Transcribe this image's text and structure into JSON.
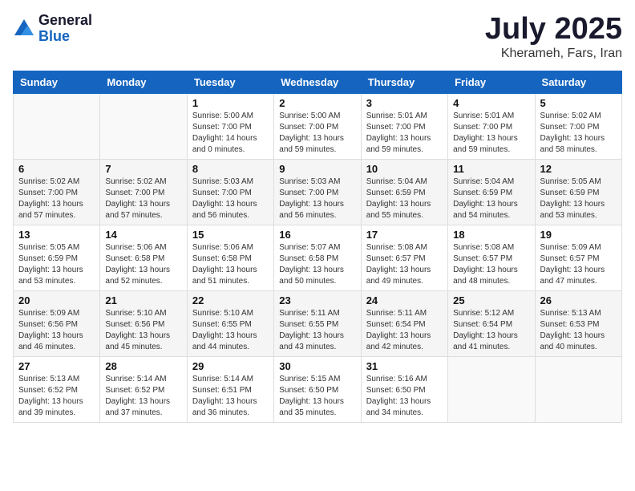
{
  "header": {
    "logo_general": "General",
    "logo_blue": "Blue",
    "title": "July 2025",
    "subtitle": "Kherameh, Fars, Iran"
  },
  "calendar": {
    "weekdays": [
      "Sunday",
      "Monday",
      "Tuesday",
      "Wednesday",
      "Thursday",
      "Friday",
      "Saturday"
    ],
    "rows": [
      [
        {
          "day": "",
          "info": ""
        },
        {
          "day": "",
          "info": ""
        },
        {
          "day": "1",
          "info": "Sunrise: 5:00 AM\nSunset: 7:00 PM\nDaylight: 14 hours\nand 0 minutes."
        },
        {
          "day": "2",
          "info": "Sunrise: 5:00 AM\nSunset: 7:00 PM\nDaylight: 13 hours\nand 59 minutes."
        },
        {
          "day": "3",
          "info": "Sunrise: 5:01 AM\nSunset: 7:00 PM\nDaylight: 13 hours\nand 59 minutes."
        },
        {
          "day": "4",
          "info": "Sunrise: 5:01 AM\nSunset: 7:00 PM\nDaylight: 13 hours\nand 59 minutes."
        },
        {
          "day": "5",
          "info": "Sunrise: 5:02 AM\nSunset: 7:00 PM\nDaylight: 13 hours\nand 58 minutes."
        }
      ],
      [
        {
          "day": "6",
          "info": "Sunrise: 5:02 AM\nSunset: 7:00 PM\nDaylight: 13 hours\nand 57 minutes."
        },
        {
          "day": "7",
          "info": "Sunrise: 5:02 AM\nSunset: 7:00 PM\nDaylight: 13 hours\nand 57 minutes."
        },
        {
          "day": "8",
          "info": "Sunrise: 5:03 AM\nSunset: 7:00 PM\nDaylight: 13 hours\nand 56 minutes."
        },
        {
          "day": "9",
          "info": "Sunrise: 5:03 AM\nSunset: 7:00 PM\nDaylight: 13 hours\nand 56 minutes."
        },
        {
          "day": "10",
          "info": "Sunrise: 5:04 AM\nSunset: 6:59 PM\nDaylight: 13 hours\nand 55 minutes."
        },
        {
          "day": "11",
          "info": "Sunrise: 5:04 AM\nSunset: 6:59 PM\nDaylight: 13 hours\nand 54 minutes."
        },
        {
          "day": "12",
          "info": "Sunrise: 5:05 AM\nSunset: 6:59 PM\nDaylight: 13 hours\nand 53 minutes."
        }
      ],
      [
        {
          "day": "13",
          "info": "Sunrise: 5:05 AM\nSunset: 6:59 PM\nDaylight: 13 hours\nand 53 minutes."
        },
        {
          "day": "14",
          "info": "Sunrise: 5:06 AM\nSunset: 6:58 PM\nDaylight: 13 hours\nand 52 minutes."
        },
        {
          "day": "15",
          "info": "Sunrise: 5:06 AM\nSunset: 6:58 PM\nDaylight: 13 hours\nand 51 minutes."
        },
        {
          "day": "16",
          "info": "Sunrise: 5:07 AM\nSunset: 6:58 PM\nDaylight: 13 hours\nand 50 minutes."
        },
        {
          "day": "17",
          "info": "Sunrise: 5:08 AM\nSunset: 6:57 PM\nDaylight: 13 hours\nand 49 minutes."
        },
        {
          "day": "18",
          "info": "Sunrise: 5:08 AM\nSunset: 6:57 PM\nDaylight: 13 hours\nand 48 minutes."
        },
        {
          "day": "19",
          "info": "Sunrise: 5:09 AM\nSunset: 6:57 PM\nDaylight: 13 hours\nand 47 minutes."
        }
      ],
      [
        {
          "day": "20",
          "info": "Sunrise: 5:09 AM\nSunset: 6:56 PM\nDaylight: 13 hours\nand 46 minutes."
        },
        {
          "day": "21",
          "info": "Sunrise: 5:10 AM\nSunset: 6:56 PM\nDaylight: 13 hours\nand 45 minutes."
        },
        {
          "day": "22",
          "info": "Sunrise: 5:10 AM\nSunset: 6:55 PM\nDaylight: 13 hours\nand 44 minutes."
        },
        {
          "day": "23",
          "info": "Sunrise: 5:11 AM\nSunset: 6:55 PM\nDaylight: 13 hours\nand 43 minutes."
        },
        {
          "day": "24",
          "info": "Sunrise: 5:11 AM\nSunset: 6:54 PM\nDaylight: 13 hours\nand 42 minutes."
        },
        {
          "day": "25",
          "info": "Sunrise: 5:12 AM\nSunset: 6:54 PM\nDaylight: 13 hours\nand 41 minutes."
        },
        {
          "day": "26",
          "info": "Sunrise: 5:13 AM\nSunset: 6:53 PM\nDaylight: 13 hours\nand 40 minutes."
        }
      ],
      [
        {
          "day": "27",
          "info": "Sunrise: 5:13 AM\nSunset: 6:52 PM\nDaylight: 13 hours\nand 39 minutes."
        },
        {
          "day": "28",
          "info": "Sunrise: 5:14 AM\nSunset: 6:52 PM\nDaylight: 13 hours\nand 37 minutes."
        },
        {
          "day": "29",
          "info": "Sunrise: 5:14 AM\nSunset: 6:51 PM\nDaylight: 13 hours\nand 36 minutes."
        },
        {
          "day": "30",
          "info": "Sunrise: 5:15 AM\nSunset: 6:50 PM\nDaylight: 13 hours\nand 35 minutes."
        },
        {
          "day": "31",
          "info": "Sunrise: 5:16 AM\nSunset: 6:50 PM\nDaylight: 13 hours\nand 34 minutes."
        },
        {
          "day": "",
          "info": ""
        },
        {
          "day": "",
          "info": ""
        }
      ]
    ]
  }
}
